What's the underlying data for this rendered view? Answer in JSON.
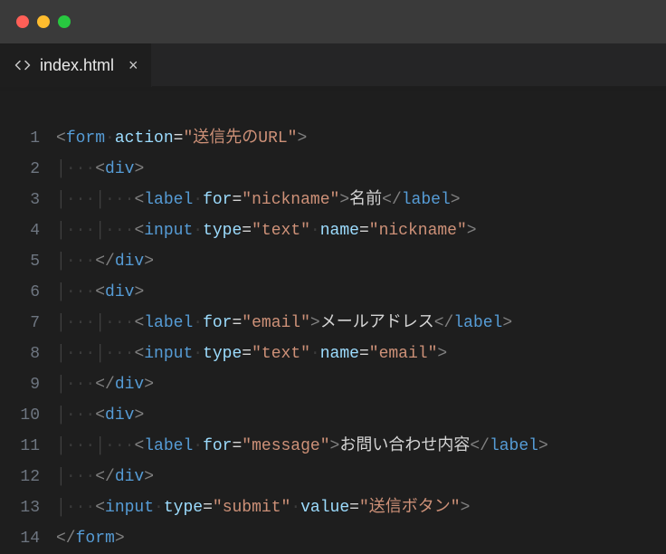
{
  "titlebar": {},
  "tab": {
    "filename": "index.html",
    "close_glyph": "×"
  },
  "gutter": [
    "1",
    "2",
    "3",
    "4",
    "5",
    "6",
    "7",
    "8",
    "9",
    "10",
    "11",
    "12",
    "13",
    "14"
  ],
  "code": {
    "lines": [
      {
        "indent": 0,
        "tokens": [
          {
            "t": "br",
            "v": "<"
          },
          {
            "t": "tag",
            "v": "form"
          },
          {
            "t": "ws",
            "v": "·"
          },
          {
            "t": "attr",
            "v": "action"
          },
          {
            "t": "eq",
            "v": "="
          },
          {
            "t": "str",
            "v": "\"送信先のURL\""
          },
          {
            "t": "br",
            "v": ">"
          }
        ]
      },
      {
        "indent": 1,
        "tokens": [
          {
            "t": "br",
            "v": "<"
          },
          {
            "t": "tag",
            "v": "div"
          },
          {
            "t": "br",
            "v": ">"
          }
        ]
      },
      {
        "indent": 2,
        "tokens": [
          {
            "t": "br",
            "v": "<"
          },
          {
            "t": "tag",
            "v": "label"
          },
          {
            "t": "ws",
            "v": "·"
          },
          {
            "t": "attr",
            "v": "for"
          },
          {
            "t": "eq",
            "v": "="
          },
          {
            "t": "str",
            "v": "\"nickname\""
          },
          {
            "t": "br",
            "v": ">"
          },
          {
            "t": "txt",
            "v": "名前"
          },
          {
            "t": "br",
            "v": "</"
          },
          {
            "t": "cltag",
            "v": "label"
          },
          {
            "t": "br",
            "v": ">"
          }
        ]
      },
      {
        "indent": 2,
        "tokens": [
          {
            "t": "br",
            "v": "<"
          },
          {
            "t": "tag",
            "v": "input"
          },
          {
            "t": "ws",
            "v": "·"
          },
          {
            "t": "attr",
            "v": "type"
          },
          {
            "t": "eq",
            "v": "="
          },
          {
            "t": "str",
            "v": "\"text\""
          },
          {
            "t": "ws",
            "v": "·"
          },
          {
            "t": "attr",
            "v": "name"
          },
          {
            "t": "eq",
            "v": "="
          },
          {
            "t": "str",
            "v": "\"nickname\""
          },
          {
            "t": "br",
            "v": ">"
          }
        ]
      },
      {
        "indent": 1,
        "tokens": [
          {
            "t": "br",
            "v": "</"
          },
          {
            "t": "cltag",
            "v": "div"
          },
          {
            "t": "br",
            "v": ">"
          }
        ]
      },
      {
        "indent": 1,
        "tokens": [
          {
            "t": "br",
            "v": "<"
          },
          {
            "t": "tag",
            "v": "div"
          },
          {
            "t": "br",
            "v": ">"
          }
        ]
      },
      {
        "indent": 2,
        "tokens": [
          {
            "t": "br",
            "v": "<"
          },
          {
            "t": "tag",
            "v": "label"
          },
          {
            "t": "ws",
            "v": "·"
          },
          {
            "t": "attr",
            "v": "for"
          },
          {
            "t": "eq",
            "v": "="
          },
          {
            "t": "str",
            "v": "\"email\""
          },
          {
            "t": "br",
            "v": ">"
          },
          {
            "t": "txt",
            "v": "メールアドレス"
          },
          {
            "t": "br",
            "v": "</"
          },
          {
            "t": "cltag",
            "v": "label"
          },
          {
            "t": "br",
            "v": ">"
          }
        ]
      },
      {
        "indent": 2,
        "tokens": [
          {
            "t": "br",
            "v": "<"
          },
          {
            "t": "tag",
            "v": "input"
          },
          {
            "t": "ws",
            "v": "·"
          },
          {
            "t": "attr",
            "v": "type"
          },
          {
            "t": "eq",
            "v": "="
          },
          {
            "t": "str",
            "v": "\"text\""
          },
          {
            "t": "ws",
            "v": "·"
          },
          {
            "t": "attr",
            "v": "name"
          },
          {
            "t": "eq",
            "v": "="
          },
          {
            "t": "str",
            "v": "\"email\""
          },
          {
            "t": "br",
            "v": ">"
          }
        ]
      },
      {
        "indent": 1,
        "tokens": [
          {
            "t": "br",
            "v": "</"
          },
          {
            "t": "cltag",
            "v": "div"
          },
          {
            "t": "br",
            "v": ">"
          }
        ]
      },
      {
        "indent": 1,
        "tokens": [
          {
            "t": "br",
            "v": "<"
          },
          {
            "t": "tag",
            "v": "div"
          },
          {
            "t": "br",
            "v": ">"
          }
        ]
      },
      {
        "indent": 2,
        "tokens": [
          {
            "t": "br",
            "v": "<"
          },
          {
            "t": "tag",
            "v": "label"
          },
          {
            "t": "ws",
            "v": "·"
          },
          {
            "t": "attr",
            "v": "for"
          },
          {
            "t": "eq",
            "v": "="
          },
          {
            "t": "str",
            "v": "\"message\""
          },
          {
            "t": "br",
            "v": ">"
          },
          {
            "t": "txt",
            "v": "お問い合わせ内容"
          },
          {
            "t": "br",
            "v": "</"
          },
          {
            "t": "cltag",
            "v": "label"
          },
          {
            "t": "br",
            "v": ">"
          }
        ]
      },
      {
        "indent": 1,
        "tokens": [
          {
            "t": "br",
            "v": "</"
          },
          {
            "t": "cltag",
            "v": "div"
          },
          {
            "t": "br",
            "v": ">"
          }
        ]
      },
      {
        "indent": 1,
        "tokens": [
          {
            "t": "br",
            "v": "<"
          },
          {
            "t": "tag",
            "v": "input"
          },
          {
            "t": "ws",
            "v": "·"
          },
          {
            "t": "attr",
            "v": "type"
          },
          {
            "t": "eq",
            "v": "="
          },
          {
            "t": "str",
            "v": "\"submit\""
          },
          {
            "t": "ws",
            "v": "·"
          },
          {
            "t": "attr",
            "v": "value"
          },
          {
            "t": "eq",
            "v": "="
          },
          {
            "t": "str",
            "v": "\"送信ボタン\""
          },
          {
            "t": "br",
            "v": ">"
          }
        ]
      },
      {
        "indent": 0,
        "tokens": [
          {
            "t": "br",
            "v": "</"
          },
          {
            "t": "cltag",
            "v": "form"
          },
          {
            "t": "br",
            "v": ">"
          }
        ]
      }
    ]
  }
}
